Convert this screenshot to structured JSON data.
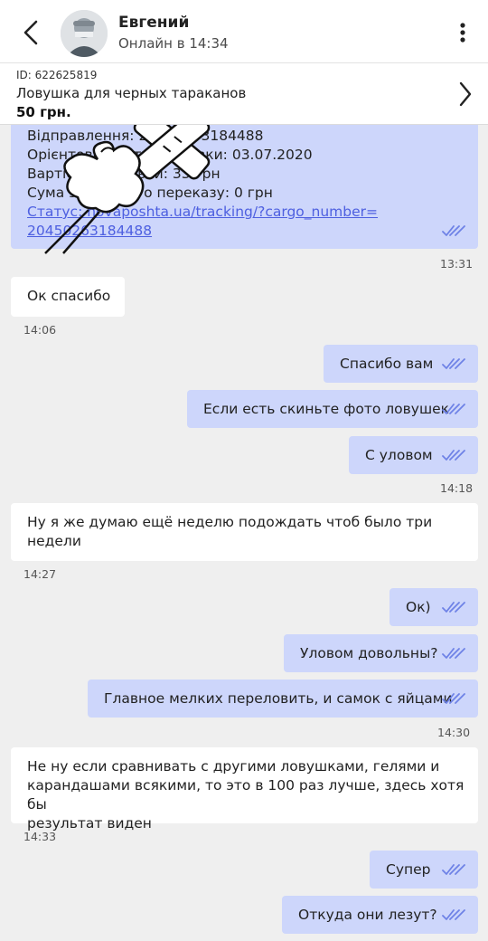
{
  "header": {
    "name": "Евгений",
    "status": "Онлайн в 14:34"
  },
  "product": {
    "id": "ID: 622625819",
    "title": "Ловушка для черных тараканов",
    "price": "50 грн."
  },
  "messages": [
    {
      "dir": "out",
      "lines": [
        "Відправлення: 20450263184488",
        "Орієнтовна дата доставки: 03.07.2020",
        "Вартість доставки: 33 грн",
        "Сума зворотного переказу: 0 грн",
        "Статус: novaposhta.ua/tracking/?cargo_number=",
        "20450263184488"
      ],
      "time": "13:31"
    },
    {
      "dir": "in",
      "text": "Ок спасибо",
      "time": "14:06"
    },
    {
      "dir": "out",
      "text": "Спасибо вам"
    },
    {
      "dir": "out",
      "text": "Если есть скиньте фото ловушек"
    },
    {
      "dir": "out",
      "text": "С уловом",
      "time": "14:18"
    },
    {
      "dir": "in",
      "lines": [
        "Ну я же думаю ещё неделю подождать чтоб было три",
        "недели"
      ],
      "time": "14:27"
    },
    {
      "dir": "out",
      "text": "Ок)"
    },
    {
      "dir": "out",
      "text": "Уловом довольны?"
    },
    {
      "dir": "out",
      "text": "Главное мелких переловить, и самок с яйцами",
      "time": "14:30"
    },
    {
      "dir": "in",
      "lines": [
        "Не ну если сравнивать с другими ловушками, гелями и",
        "карандашами всякими, то это в 100 раз лучше, здесь хотя бы",
        "результат виден"
      ],
      "time": "14:33"
    },
    {
      "dir": "out",
      "text": "Супер"
    },
    {
      "dir": "out",
      "text": "Откуда они лезут?"
    }
  ],
  "colors": {
    "outgoing": "#cdd6fb",
    "incoming": "#ffffff",
    "ticks": "#6e82e6",
    "link": "#4d5fe0"
  },
  "icons": {
    "back": "chevron-left-icon",
    "menu": "more-vertical-icon",
    "product": "chevron-right-icon",
    "read": "double-check-icon"
  }
}
